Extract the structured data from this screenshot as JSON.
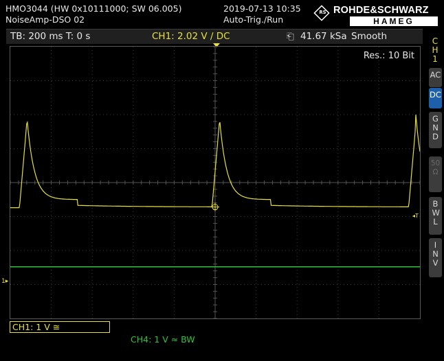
{
  "header": {
    "device": "HMO3044 (HW 0x10111000; SW 06.005)",
    "setup_name": "NoiseAmp-DSO 02",
    "datetime": "2019-07-13 10:35",
    "trigger_state": "Auto-Trig./Run"
  },
  "logo": {
    "emblem": "RS",
    "brand": "ROHDE&SCHWARZ",
    "sub_brand": "HAMEG"
  },
  "status_bar": {
    "timebase": "TB: 200 ms  T: 0 s",
    "ch1_setting": "CH1: 2.02 V ∕ DC",
    "acquire_icon": "⎗",
    "sample_rate": "41.67 kSa",
    "acquire_mode": "Smooth"
  },
  "screen": {
    "resolution_label": "Res.: 10 Bit"
  },
  "side_menu": {
    "channel_tab": "CH1",
    "ac": "AC",
    "dc": "DC",
    "gnd": "GND",
    "fifty_ohm": "50Ω",
    "bwl": "BWL",
    "inv": "INV",
    "selected": "DC"
  },
  "footer": {
    "ch1_label": "CH1: 1 V ≅",
    "ch4_label": "CH4: 1 V ≈ BW"
  },
  "markers": {
    "ch1_level": "1▸",
    "trigger_level": "◂T"
  },
  "colors": {
    "ch1": "#e6e040",
    "ch4": "#2ec43a",
    "grid": "#3a3a3a",
    "selected_button": "#1d5fa8"
  },
  "waveforms": {
    "ch1_baseline_div": -0.72,
    "ch1_peak_div": 2.0,
    "ch1_pulse_times_s": [
      -0.92,
      0.02,
      0.98
    ],
    "ch4_level_div": -2.48,
    "time_per_div_s": 0.2
  }
}
